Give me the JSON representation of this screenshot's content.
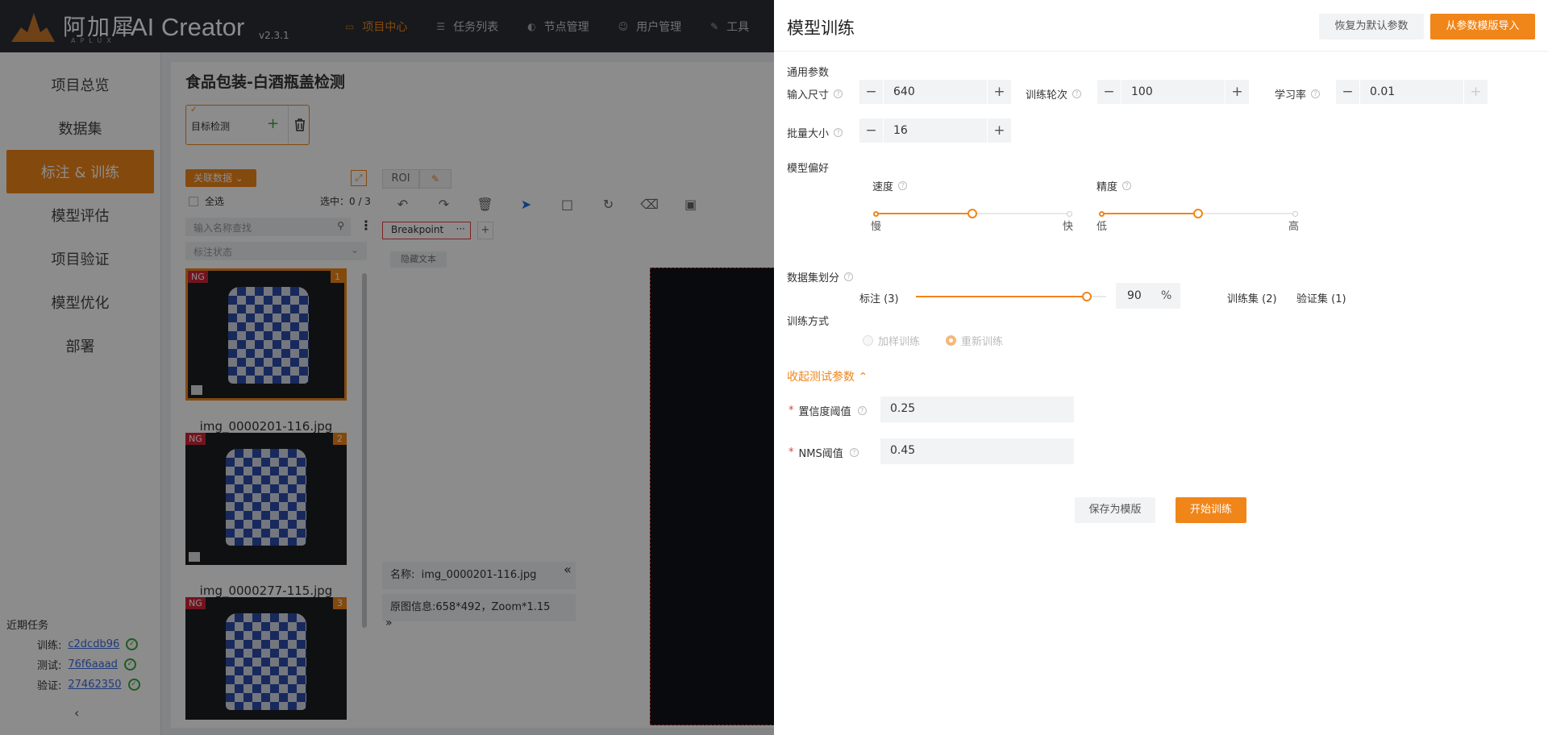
{
  "brand": {
    "name_cn": "阿加犀",
    "name_en": "APLUX",
    "app": "AI Creator",
    "version": "v2.3.1"
  },
  "nav": [
    {
      "label": "项目中心",
      "icon": "folder-icon"
    },
    {
      "label": "任务列表",
      "icon": "list-icon"
    },
    {
      "label": "节点管理",
      "icon": "node-icon"
    },
    {
      "label": "用户管理",
      "icon": "user-icon"
    },
    {
      "label": "工具",
      "icon": "wrench-icon"
    }
  ],
  "sidebar": {
    "items": [
      "项目总览",
      "数据集",
      "标注 & 训练",
      "模型评估",
      "项目验证",
      "模型优化",
      "部署"
    ]
  },
  "recent": {
    "title": "近期任务",
    "rows": [
      {
        "label": "训练:",
        "id": "c2dcdb96"
      },
      {
        "label": "测试:",
        "id": "76f6aaad"
      },
      {
        "label": "验证:",
        "id": "27462350"
      }
    ]
  },
  "project": {
    "title": "食品包装-白酒瓶盖检测",
    "task": "目标检测"
  },
  "list": {
    "relate": "关联数据",
    "select_all": "全选",
    "selected": "选中：0 / 3",
    "search_placeholder": "输入名称查找",
    "status_placeholder": "标注状态",
    "images": [
      {
        "badge": "NG",
        "num": "1",
        "name": "img_0000201-116.jpg"
      },
      {
        "badge": "NG",
        "num": "2",
        "name": "img_0000277-115.jpg"
      },
      {
        "badge": "NG",
        "num": "3",
        "name": ""
      }
    ]
  },
  "editor": {
    "roi": "ROI",
    "breakpoint": "Breakpoint",
    "hide_text": "隐藏文本",
    "name_label": "名称:",
    "name_value": "img_0000201-116.jpg",
    "info_label": "原图信息:",
    "info_value": "658*492，Zoom*1.15"
  },
  "drawer": {
    "title": "模型训练",
    "reset": "恢复为默认参数",
    "import": "从参数模版导入",
    "general": "通用参数",
    "params": {
      "input_size": {
        "label": "输入尺寸",
        "value": "640"
      },
      "epochs": {
        "label": "训练轮次",
        "value": "100"
      },
      "lr": {
        "label": "学习率",
        "value": "0.01"
      },
      "batch": {
        "label": "批量大小",
        "value": "16"
      }
    },
    "pref": {
      "title": "模型偏好",
      "speed": {
        "label": "速度",
        "min": "慢",
        "max": "快",
        "level": 0.5
      },
      "accuracy": {
        "label": "精度",
        "min": "低",
        "max": "高",
        "level": 0.5
      }
    },
    "split": {
      "title": "数据集划分",
      "labeled": "标注 (3)",
      "percent": "90",
      "unit": "%",
      "train": "训练集 (2)",
      "val": "验证集 (1)"
    },
    "mode": {
      "title": "训练方式",
      "opt1": "加样训练",
      "opt2": "重新训练"
    },
    "fold": "收起测试参数",
    "conf": {
      "label": "置信度阈值",
      "value": "0.25"
    },
    "nms": {
      "label": "NMS阈值",
      "value": "0.45"
    },
    "save": "保存为模版",
    "start": "开始训练"
  },
  "colors": {
    "accent": "#f08519",
    "topbar": "#2b2f36",
    "ng": "#d0253a"
  }
}
